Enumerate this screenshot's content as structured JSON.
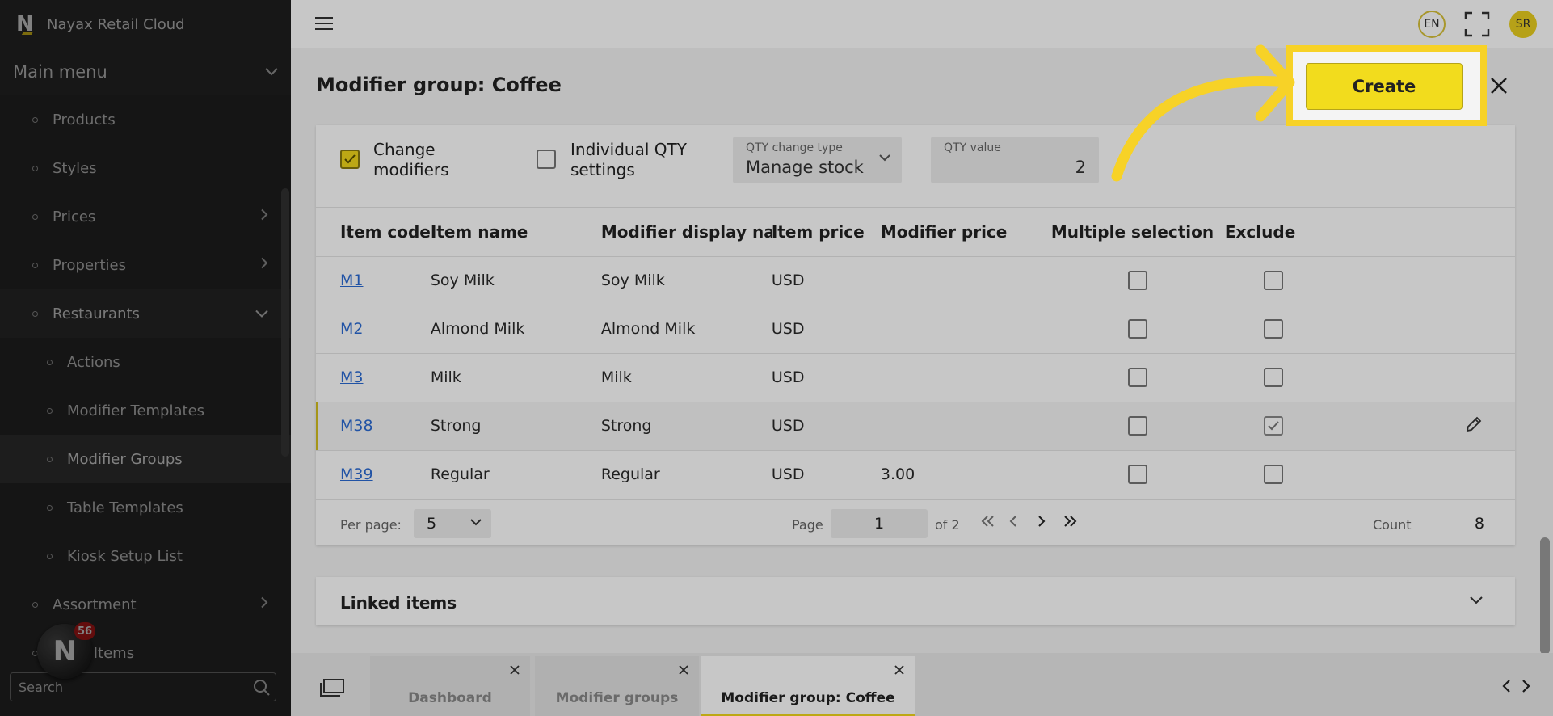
{
  "app": {
    "title": "Nayax Retail Cloud",
    "logo_letter": "N"
  },
  "sidebar": {
    "main_menu_label": "Main menu",
    "items": [
      {
        "label": "Products",
        "level": 1,
        "chevron": "none"
      },
      {
        "label": "Styles",
        "level": 1,
        "chevron": "none"
      },
      {
        "label": "Prices",
        "level": 1,
        "chevron": "right"
      },
      {
        "label": "Properties",
        "level": 1,
        "chevron": "right"
      },
      {
        "label": "Restaurants",
        "level": 1,
        "chevron": "down"
      },
      {
        "label": "Actions",
        "level": 2,
        "chevron": "none"
      },
      {
        "label": "Modifier Templates",
        "level": 2,
        "chevron": "none"
      },
      {
        "label": "Modifier Groups",
        "level": 2,
        "chevron": "none",
        "selected": true
      },
      {
        "label": "Table Templates",
        "level": 2,
        "chevron": "none"
      },
      {
        "label": "Kiosk Setup List",
        "level": 2,
        "chevron": "none"
      },
      {
        "label": "Assortment",
        "level": 1,
        "chevron": "right"
      },
      {
        "label": "...ing Items",
        "level": 1,
        "chevron": "none"
      }
    ],
    "search_placeholder": "Search",
    "fab_badge": "56"
  },
  "topbar": {
    "language": "EN",
    "user_initials": "SR"
  },
  "page": {
    "title": "Modifier group: Coffee",
    "create_label": "Create",
    "toolbar": {
      "change_modifiers_label": "Change modifiers",
      "change_modifiers_checked": true,
      "individual_qty_label": "Individual QTY settings",
      "individual_qty_checked": false,
      "qty_change_type_label": "QTY change type",
      "qty_change_type_value": "Manage stock",
      "qty_value_label": "QTY value",
      "qty_value": "2"
    },
    "table": {
      "columns": [
        "Item code",
        "Item name",
        "Modifier display nai",
        "Item price",
        "Modifier price",
        "Multiple selection",
        "Exclude"
      ],
      "rows": [
        {
          "code": "M1",
          "name": "Soy Milk",
          "display": "Soy Milk",
          "price": "USD",
          "modifier_price": "",
          "multiple": false,
          "exclude": false
        },
        {
          "code": "M2",
          "name": "Almond Milk",
          "display": "Almond Milk",
          "price": "USD",
          "modifier_price": "",
          "multiple": false,
          "exclude": false
        },
        {
          "code": "M3",
          "name": "Milk",
          "display": "Milk",
          "price": "USD",
          "modifier_price": "",
          "multiple": false,
          "exclude": false
        },
        {
          "code": "M38",
          "name": "Strong",
          "display": "Strong",
          "price": "USD",
          "modifier_price": "",
          "multiple": false,
          "exclude": true,
          "active": true
        },
        {
          "code": "M39",
          "name": "Regular",
          "display": "Regular",
          "price": "USD",
          "modifier_price": "3.00",
          "multiple": false,
          "exclude": false
        }
      ]
    },
    "pager": {
      "per_page_label": "Per page:",
      "per_page": "5",
      "page_label": "Page",
      "page": "1",
      "of_label": "of 2",
      "count_label": "Count",
      "count": "8"
    },
    "linked_items_label": "Linked items"
  },
  "tabs": [
    {
      "label": "Dashboard",
      "active": false
    },
    {
      "label": "Modifier groups",
      "active": false
    },
    {
      "label": "Modifier group: Coffee",
      "active": true
    }
  ],
  "colors": {
    "accent": "#f3d81c",
    "sidebar_bg": "#2b2b2b",
    "link": "#2b6bd4",
    "highlight": "#f7d227",
    "badge": "#c41b1b"
  }
}
